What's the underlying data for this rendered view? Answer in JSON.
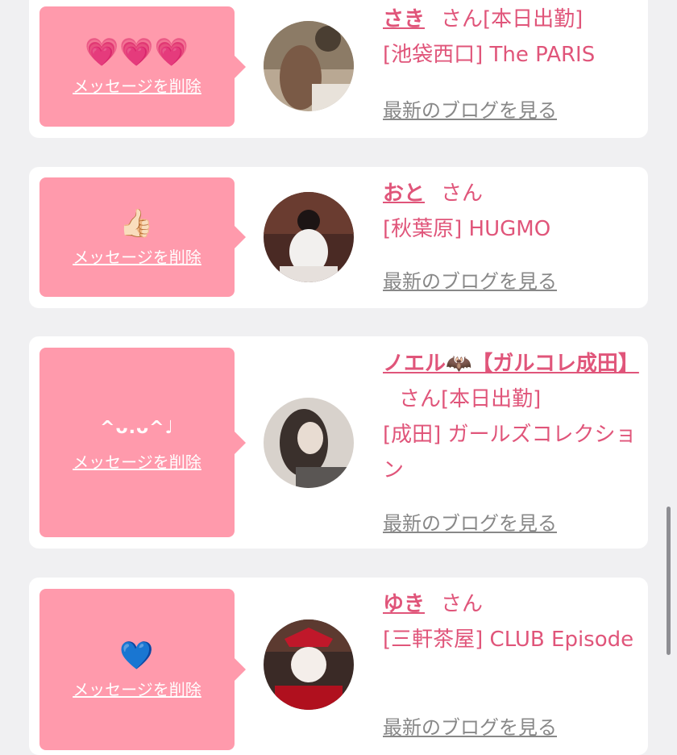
{
  "cards": [
    {
      "reaction": "💗💗💗",
      "delete_label": "メッセージを削除",
      "name": "さき",
      "honorific": "さん",
      "status": "[本日出勤]",
      "shop": "[池袋西口] The PARIS",
      "blog_label": "最新のブログを見る"
    },
    {
      "reaction": "👍🏻",
      "delete_label": "メッセージを削除",
      "name": "おと",
      "honorific": "さん",
      "status": "",
      "shop": "[秋葉原] HUGMO",
      "blog_label": "最新のブログを見る"
    },
    {
      "reaction": "^ᴗ.ᴗ^♩",
      "delete_label": "メッセージを削除",
      "name": "ノエル🦇【ガルコレ成田】",
      "honorific": "さん",
      "status": "[本日出勤]",
      "shop": "[成田] ガールズコレクション",
      "blog_label": "最新のブログを見る"
    },
    {
      "reaction": "💙",
      "delete_label": "メッセージを削除",
      "name": "ゆき",
      "honorific": "さん",
      "status": "",
      "shop": "[三軒茶屋] CLUB Episode",
      "blog_label": "最新のブログを見る"
    }
  ],
  "colors": {
    "accent": "#e0557a",
    "bubble": "#ff9aac",
    "link_gray": "#888888",
    "background": "#f0f0f2"
  }
}
